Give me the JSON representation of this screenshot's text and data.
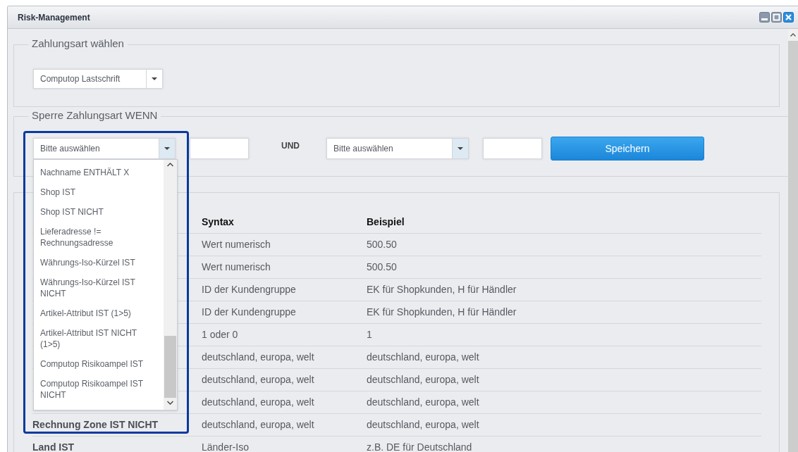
{
  "window": {
    "title": "Risk-Management"
  },
  "payment_section": {
    "legend": "Zahlungsart wählen",
    "select": {
      "value": "Computop Lastschrift"
    }
  },
  "rule_section": {
    "legend": "Sperre Zahlungsart WENN",
    "condition_select": {
      "value": "Bitte auswählen",
      "expanded": true
    },
    "connector": "UND",
    "second_select": {
      "value": "Bitte auswählen"
    },
    "save_button": "Speichern"
  },
  "dropdown_options": [
    "Nachname ENTHÄLT X",
    "Shop IST",
    "Shop IST NICHT",
    "Lieferadresse != Rechnungsadresse",
    "Währungs-Iso-Kürzel IST",
    "Währungs-Iso-Kürzel IST NICHT",
    "Artikel-Attribut IST (1>5)",
    "Artikel-Attribut IST NICHT (1>5)",
    "Computop Risikoampel IST",
    "Computop Risikoampel IST NICHT"
  ],
  "table": {
    "columns": [
      {
        "label": "Syntax"
      },
      {
        "label": "Beispiel"
      }
    ],
    "rows": [
      {
        "syntax": "Wert numerisch",
        "example": "500.50"
      },
      {
        "syntax": "Wert numerisch",
        "example": "500.50"
      },
      {
        "syntax": "ID der Kundengruppe",
        "example": "EK für Shopkunden, H für Händler"
      },
      {
        "syntax": "ID der Kundengruppe",
        "example": "EK für Shopkunden, H für Händler"
      },
      {
        "syntax": "1 oder 0",
        "example": "1"
      },
      {
        "syntax": "deutschland, europa, welt",
        "example": "deutschland, europa, welt"
      },
      {
        "syntax": "deutschland, europa, welt",
        "example": "deutschland, europa, welt"
      },
      {
        "syntax": "deutschland, europa, welt",
        "example": "deutschland, europa, welt"
      },
      {
        "condition": "Rechnung Zone IST NICHT",
        "syntax": "deutschland, europa, welt",
        "example": "deutschland, europa, welt"
      },
      {
        "condition": "Land IST",
        "syntax": "Länder-Iso",
        "example": "z.B. DE für Deutschland"
      }
    ]
  }
}
